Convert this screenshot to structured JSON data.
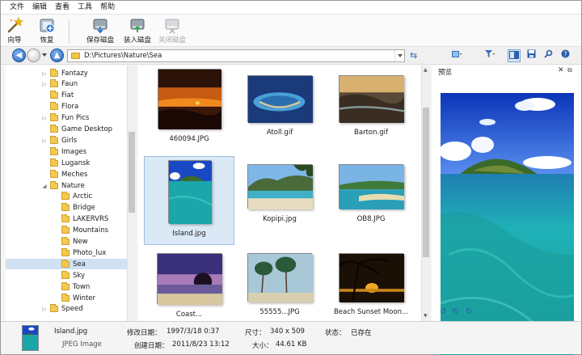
{
  "menubar": {
    "items": [
      "文件",
      "编辑",
      "查看",
      "工具",
      "帮助"
    ]
  },
  "toolbar": {
    "buttons": [
      {
        "label": "向导",
        "icon": "wizard-icon",
        "enabled": true
      },
      {
        "label": "恢复",
        "icon": "restore-icon",
        "enabled": true
      },
      {
        "label": "保存磁盘",
        "icon": "save-disk-icon",
        "enabled": true
      },
      {
        "label": "装入磁盘",
        "icon": "load-disk-icon",
        "enabled": true
      },
      {
        "label": "关闭磁盘",
        "icon": "close-disk-icon",
        "enabled": false
      }
    ]
  },
  "address": {
    "path": "D:\\Pictures\\Nature\\Sea"
  },
  "tree": {
    "items": [
      {
        "label": "Fantazy",
        "expander": "▷",
        "level": 1
      },
      {
        "label": "Faun",
        "expander": "▷",
        "level": 1
      },
      {
        "label": "Fiat",
        "expander": "",
        "level": 1
      },
      {
        "label": "Flora",
        "expander": "",
        "level": 1
      },
      {
        "label": "Fun Pics",
        "expander": "▷",
        "level": 1
      },
      {
        "label": "Game Desktop",
        "expander": "",
        "level": 1
      },
      {
        "label": "Girls",
        "expander": "▷",
        "level": 1
      },
      {
        "label": "Images",
        "expander": "",
        "level": 1
      },
      {
        "label": "Lugansk",
        "expander": "",
        "level": 1
      },
      {
        "label": "Meches",
        "expander": "",
        "level": 1
      },
      {
        "label": "Nature",
        "expander": "◢",
        "level": 1
      },
      {
        "label": "Arctic",
        "expander": "",
        "level": 2
      },
      {
        "label": "Bridge",
        "expander": "",
        "level": 2
      },
      {
        "label": "LAKERVRS",
        "expander": "",
        "level": 2
      },
      {
        "label": "Mountains",
        "expander": "",
        "level": 2
      },
      {
        "label": "New",
        "expander": "",
        "level": 2
      },
      {
        "label": "Photo_lux",
        "expander": "",
        "level": 2
      },
      {
        "label": "Sea",
        "expander": "",
        "level": 2,
        "selected": true
      },
      {
        "label": "Sky",
        "expander": "",
        "level": 2
      },
      {
        "label": "Town",
        "expander": "",
        "level": 2
      },
      {
        "label": "Winter",
        "expander": "",
        "level": 2
      },
      {
        "label": "Speed",
        "expander": "▷",
        "level": 1
      }
    ]
  },
  "thumbnails": [
    {
      "name": "460094.JPG",
      "kind": "sunset-orange"
    },
    {
      "name": "Atoll.gif",
      "kind": "atoll"
    },
    {
      "name": "Barton.gif",
      "kind": "rocky-shore"
    },
    {
      "name": "Island.jpg",
      "kind": "island",
      "selected": true
    },
    {
      "name": "Kopipi.jpg",
      "kind": "bay"
    },
    {
      "name": "OB8.JPG",
      "kind": "lagoon"
    },
    {
      "name": "Coast...",
      "kind": "purple-rock"
    },
    {
      "name": "55555...JPG",
      "kind": "palms"
    },
    {
      "name": "Beach Sunset Moon...",
      "kind": "night-palms"
    }
  ],
  "preview": {
    "title": "预览"
  },
  "status": {
    "filename": "Island.jpg",
    "filetype": "JPEG Image",
    "modified_label": "修改日期：",
    "modified_value": "1997/3/18 0:37",
    "created_label": "创建日期：",
    "created_value": "2011/8/23 13:12",
    "dims_label": "尺寸：",
    "dims_value": "340 x 509",
    "size_label": "大小：",
    "size_value": "44.61 KB",
    "state_label": "状态：",
    "state_value": "已存在"
  }
}
